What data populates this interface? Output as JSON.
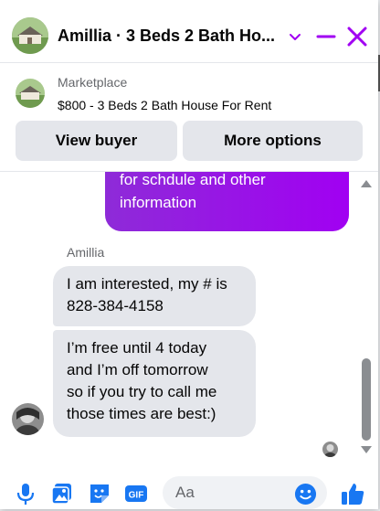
{
  "header": {
    "title": "Amillia · 3 Beds 2 Bath Ho...",
    "icons": [
      "chevron-down-icon",
      "minimize-icon",
      "close-icon"
    ]
  },
  "marketplace": {
    "label": "Marketplace",
    "listing": "$800 - 3 Beds 2 Bath House For Rent",
    "buttons": {
      "view_buyer": "View buyer",
      "more_options": "More options"
    }
  },
  "messages": {
    "outgoing_partial": [
      "for schdule and other",
      "information"
    ],
    "sender_name": "Amillia",
    "incoming": [
      [
        "I am interested, my # is",
        "828-384-4158"
      ],
      [
        "I’m free until 4 today",
        "and I’m off tomorrow",
        "so if you try to call me",
        "those times are best:)"
      ]
    ]
  },
  "composer": {
    "placeholder": "Aa",
    "icons": [
      "microphone-icon",
      "photo-icon",
      "sticker-icon",
      "gif-icon",
      "emoji-icon",
      "like-icon"
    ]
  },
  "colors": {
    "accent": "#a100f2",
    "bubble_in": "#e4e6eb",
    "like": "#1877f2"
  }
}
